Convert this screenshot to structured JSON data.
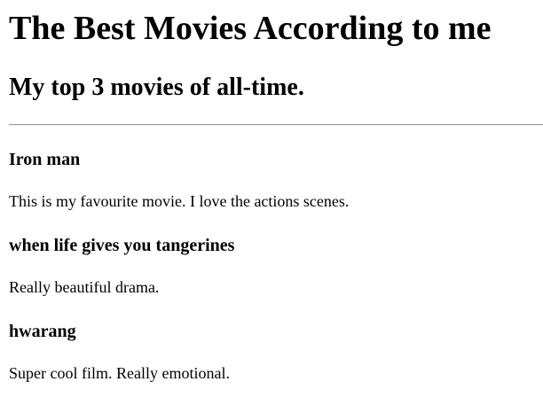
{
  "page": {
    "title": "The Best Movies According to me",
    "subtitle": "My top 3 movies of all-time."
  },
  "movies": [
    {
      "title": "Iron man",
      "description": "This is my favourite movie. I love the actions scenes."
    },
    {
      "title": "when life gives you tangerines",
      "description": "Really beautiful drama."
    },
    {
      "title": "hwarang",
      "description": "Super cool film. Really emotional."
    }
  ]
}
